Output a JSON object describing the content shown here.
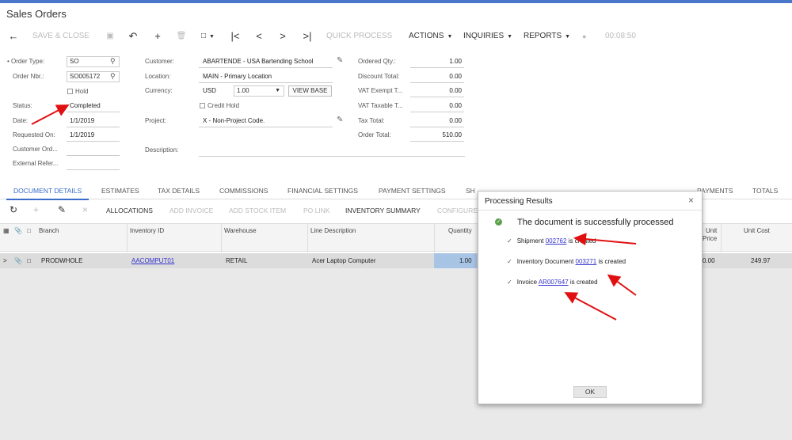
{
  "window": {
    "title": "Sales Orders"
  },
  "toolbar": {
    "save_close": "SAVE & CLOSE",
    "quick_process": "QUICK PROCESS",
    "actions": "ACTIONS",
    "inquiries": "INQUIRIES",
    "reports": "REPORTS",
    "timer": "00:08:50"
  },
  "form": {
    "order_type_label": "Order Type:",
    "order_type": "SO",
    "order_nbr_label": "Order Nbr.:",
    "order_nbr": "SO005172",
    "hold_label": "Hold",
    "status_label": "Status:",
    "status": "Completed",
    "date_label": "Date:",
    "date": "1/1/2019",
    "requested_on_label": "Requested On:",
    "requested_on": "1/1/2019",
    "customer_ord_label": "Customer Ord...",
    "external_ref_label": "External Refer...",
    "customer_label": "Customer:",
    "customer": "ABARTENDE - USA Bartending School",
    "location_label": "Location:",
    "location": "MAIN - Primary Location",
    "currency_label": "Currency:",
    "currency": "USD",
    "rate": "1.00",
    "view_base": "VIEW BASE",
    "credit_hold_label": "Credit Hold",
    "project_label": "Project:",
    "project": "X - Non-Project Code.",
    "description_label": "Description:",
    "ordered_qty_label": "Ordered Qty.:",
    "ordered_qty": "1.00",
    "discount_total_label": "Discount Total:",
    "discount_total": "0.00",
    "vat_exempt_label": "VAT Exempt T...",
    "vat_exempt": "0.00",
    "vat_taxable_label": "VAT Taxable T...",
    "vat_taxable": "0.00",
    "tax_total_label": "Tax Total:",
    "tax_total": "0.00",
    "order_total_label": "Order Total:",
    "order_total": "510.00"
  },
  "tabs": [
    "DOCUMENT DETAILS",
    "ESTIMATES",
    "TAX DETAILS",
    "COMMISSIONS",
    "FINANCIAL SETTINGS",
    "PAYMENT SETTINGS",
    "SH",
    "PAYMENTS",
    "TOTALS"
  ],
  "grid_toolbar": {
    "allocations": "ALLOCATIONS",
    "add_invoice": "ADD INVOICE",
    "add_stock_item": "ADD STOCK ITEM",
    "po_link": "PO LINK",
    "inventory_summary": "INVENTORY SUMMARY",
    "configure": "CONFIGURE"
  },
  "grid": {
    "headers": {
      "branch": "Branch",
      "inventory_id": "Inventory ID",
      "warehouse": "Warehouse",
      "line_description": "Line Description",
      "quantity": "Quantity",
      "unit_price_1": "Unit",
      "unit_price_2": "Price",
      "unit_cost": "Unit Cost"
    },
    "row": {
      "branch": "PRODWHOLE",
      "inventory_id": "AACOMPUT01",
      "warehouse": "RETAIL",
      "line_description": "Acer Laptop Computer",
      "quantity": "1.00",
      "unit_price": "0.00",
      "unit_cost": "249.97"
    }
  },
  "dialog": {
    "title": "Processing Results",
    "message": "The document is successfully processed",
    "results": [
      {
        "prefix": "Shipment ",
        "link": "002762",
        "suffix": " is created"
      },
      {
        "prefix": "Inventory Document ",
        "link": "003271",
        "suffix": " is created"
      },
      {
        "prefix": "Invoice ",
        "link": "AR007647",
        "suffix": " is created"
      }
    ],
    "ok": "OK"
  },
  "colors": {
    "accent": "#3a6bc8",
    "arrow": "#e01010",
    "success": "#5aa04a",
    "topbar": "#4a77c9"
  }
}
